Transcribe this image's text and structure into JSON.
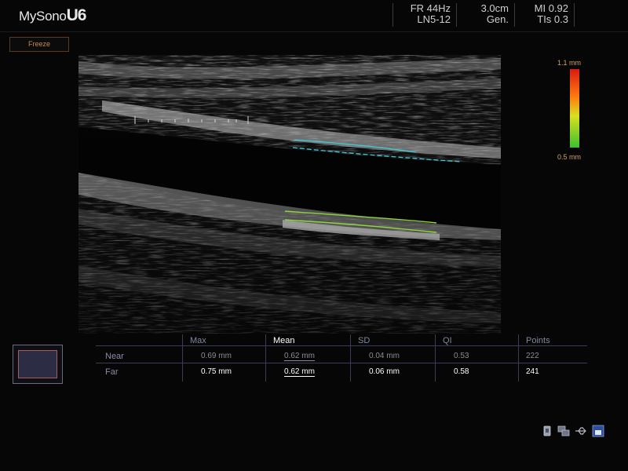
{
  "header": {
    "logo_text": "MySono",
    "logo_model": "U6",
    "frame_rate": "FR 44Hz",
    "probe": "LN5-12",
    "depth": "3.0cm",
    "mode": "Gen.",
    "mi": "MI 0.92",
    "tis": "TIs 0.3"
  },
  "freeze": {
    "label": "Freeze"
  },
  "color_scale": {
    "max_label": "1.1 mm",
    "min_label": "0.5 mm"
  },
  "table": {
    "headers": [
      "Max",
      "Mean",
      "SD",
      "QI",
      "Points"
    ],
    "active_header": "Mean",
    "rows": [
      {
        "label": "Near",
        "max": "0.69 mm",
        "mean": "0.62 mm",
        "sd": "0.04 mm",
        "qi": "0.53",
        "points": "222"
      },
      {
        "label": "Far",
        "max": "0.75 mm",
        "mean": "0.62 mm",
        "sd": "0.06 mm",
        "qi": "0.58",
        "points": "241"
      }
    ]
  },
  "status_icons": [
    "probe-status-icon",
    "network-icon",
    "usb-icon",
    "storage-icon"
  ],
  "colors": {
    "near_wall_trace": "#3fc6d2",
    "far_wall_trace": "#8cd63a",
    "accent_orange": "#c98a50"
  }
}
